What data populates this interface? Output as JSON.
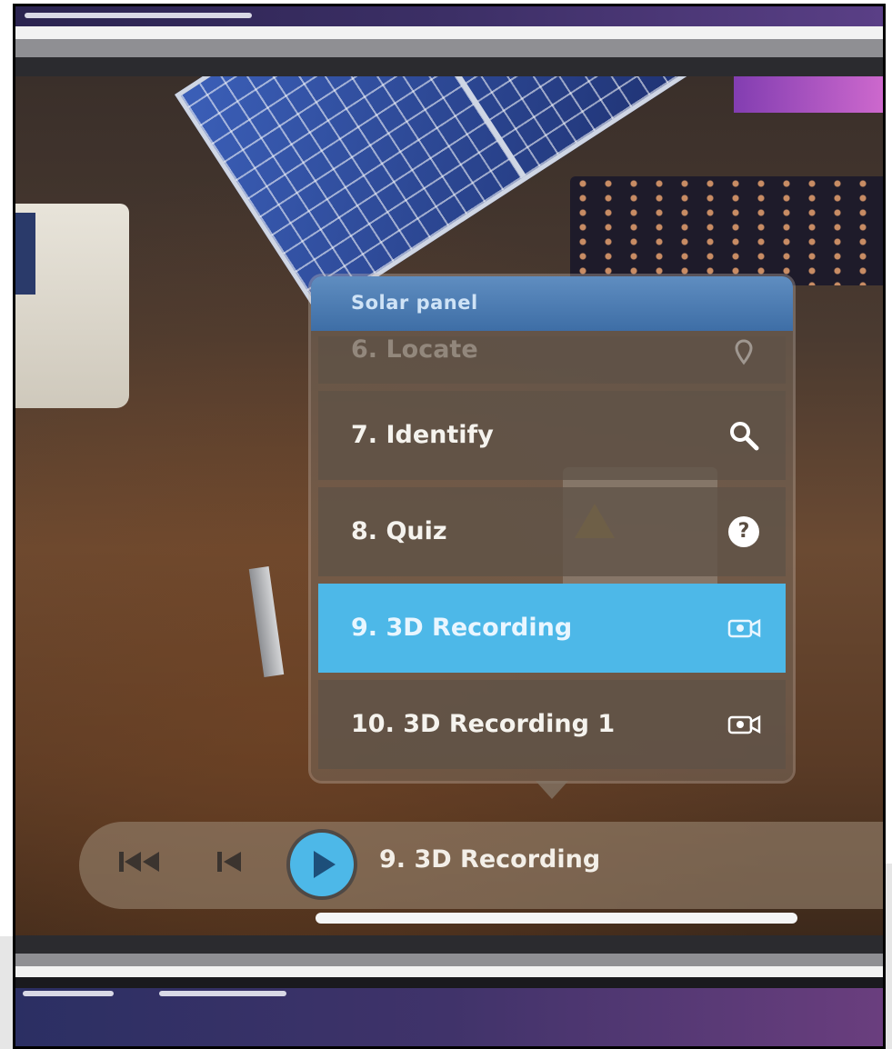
{
  "menu": {
    "header": "Solar panel",
    "items": [
      {
        "label": "6. Locate",
        "icon": "location-pin-icon"
      },
      {
        "label": "7. Identify",
        "icon": "search-icon"
      },
      {
        "label": "8. Quiz",
        "icon": "question-icon"
      },
      {
        "label": "9. 3D Recording",
        "icon": "3d-camera-icon",
        "active": true
      },
      {
        "label": "10. 3D Recording 1",
        "icon": "3d-camera-icon"
      }
    ]
  },
  "player": {
    "current_track": "9. 3D Recording"
  },
  "colors": {
    "accent": "#4db8e8",
    "header": "#4e7fb5"
  }
}
